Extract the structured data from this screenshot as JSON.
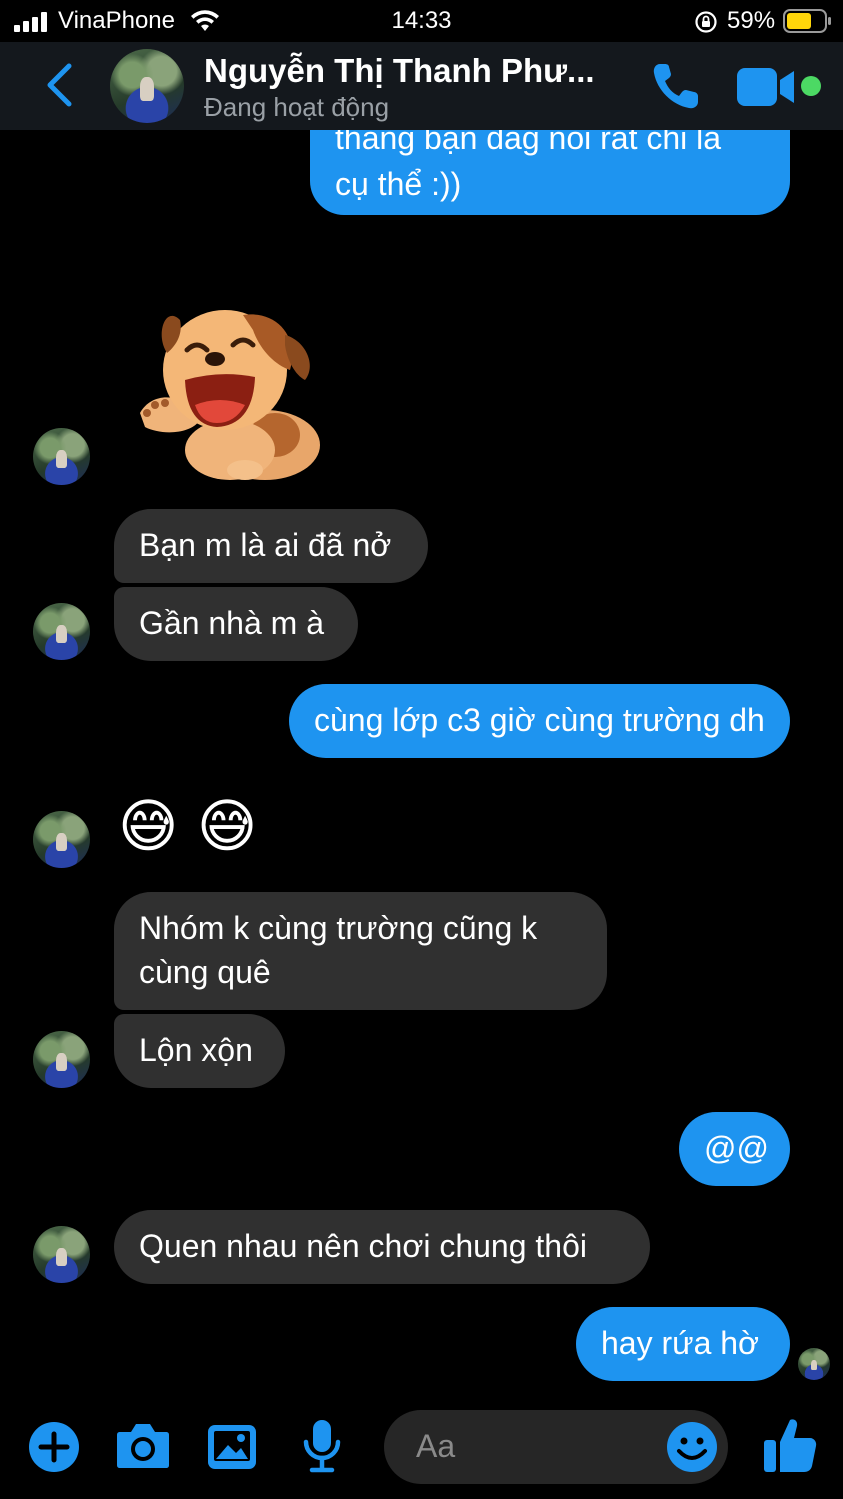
{
  "status_bar": {
    "carrier": "VinaPhone",
    "time": "14:33",
    "battery_percent": "59%"
  },
  "header": {
    "contact_name": "Nguyễn Thị Thanh Phư...",
    "status": "Đang hoạt động"
  },
  "messages": [
    {
      "id": "m0",
      "from": "me",
      "text_lines": [
        "thằng bạn đag nói rất chi là",
        "cụ thể :))"
      ]
    },
    {
      "id": "m1",
      "from": "them",
      "type": "sticker",
      "sticker": "laughing-puppy"
    },
    {
      "id": "m2",
      "from": "them",
      "text": "Bạn m là ai đã nở"
    },
    {
      "id": "m3",
      "from": "them",
      "text": "Gần nhà m à"
    },
    {
      "id": "m4",
      "from": "me",
      "text": "cùng lớp c3 giờ cùng trường dh"
    },
    {
      "id": "m5",
      "from": "them",
      "type": "emoji",
      "text": "😅 😅"
    },
    {
      "id": "m6",
      "from": "them",
      "text_lines": [
        "Nhóm k cùng trường cũng k",
        "cùng quê"
      ]
    },
    {
      "id": "m7",
      "from": "them",
      "text": "Lộn xộn"
    },
    {
      "id": "m8",
      "from": "me",
      "text": "@@"
    },
    {
      "id": "m9",
      "from": "them",
      "text": "Quen nhau nên chơi chung thôi"
    },
    {
      "id": "m10",
      "from": "me",
      "text": "hay rứa hờ"
    }
  ],
  "composer": {
    "placeholder": "Aa"
  },
  "colors": {
    "accent": "#1e94f0",
    "incoming_bubble": "#303030",
    "active_dot": "#4cd964"
  }
}
